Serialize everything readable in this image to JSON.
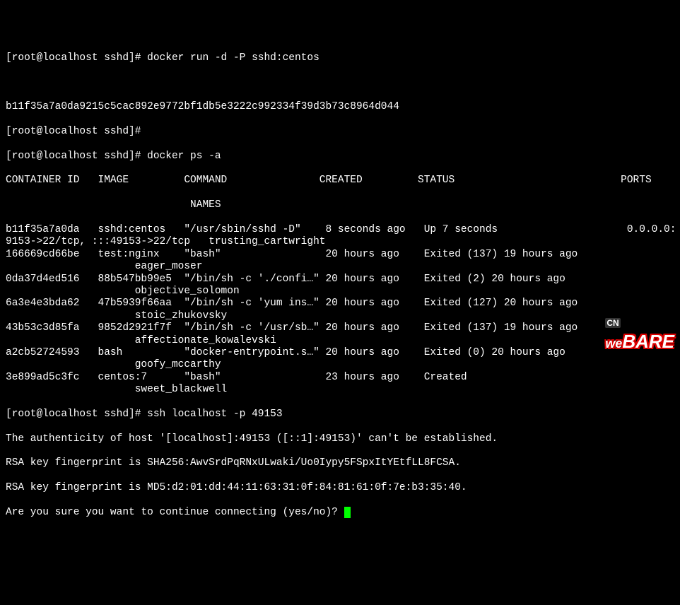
{
  "prompt": "[root@localhost sshd]#",
  "cmd1": "docker run -d -P sshd:centos",
  "output1": "b11f35a7a0da9215c5cac892e9772bf1db5e3222c992334f39d3b73c8964d044",
  "cmd2": "docker ps -a",
  "table_header": "CONTAINER ID   IMAGE         COMMAND               CREATED         STATUS                           PORTS",
  "table_header2": "                              NAMES",
  "rows": [
    {
      "l1": "b11f35a7a0da   sshd:centos   \"/usr/sbin/sshd -D\"    8 seconds ago   Up 7 seconds                     0.0.0.0:",
      "l2": "9153->22/tcp, :::49153->22/tcp   trusting_cartwright"
    },
    {
      "l1": "166669cd66be   test:nginx    \"bash\"                 20 hours ago    Exited (137) 19 hours ago",
      "l2": "                     eager_moser"
    },
    {
      "l1": "0da37d4ed516   88b547bb99e5  \"/bin/sh -c './confi…\" 20 hours ago    Exited (2) 20 hours ago",
      "l2": "                     objective_solomon"
    },
    {
      "l1": "6a3e4e3bda62   47b5939f66aa  \"/bin/sh -c 'yum ins…\" 20 hours ago    Exited (127) 20 hours ago",
      "l2": "                     stoic_zhukovsky"
    },
    {
      "l1": "43b53c3d85fa   9852d2921f7f  \"/bin/sh -c '/usr/sb…\" 20 hours ago    Exited (137) 19 hours ago",
      "l2": "                     affectionate_kowalevski"
    },
    {
      "l1": "a2cb52724593   bash          \"docker-entrypoint.s…\" 20 hours ago    Exited (0) 20 hours ago",
      "l2": "                     goofy_mccarthy"
    },
    {
      "l1": "3e899ad5c3fc   centos:7      \"bash\"                 23 hours ago    Created",
      "l2": "                     sweet_blackwell"
    }
  ],
  "cmd3": "ssh localhost -p 49153",
  "ssh_lines": [
    "The authenticity of host '[localhost]:49153 ([::1]:49153)' can't be established.",
    "RSA key fingerprint is SHA256:AwvSrdPqRNxULwaki/Uo0Iypy5FSpxItYEtfLL8FCSA.",
    "RSA key fingerprint is MD5:d2:01:dd:44:11:63:31:0f:84:81:61:0f:7e:b3:35:40.",
    "Are you sure you want to continue connecting (yes/no)? "
  ],
  "watermark": {
    "cn": "CN",
    "we": "we",
    "bare": "BARE"
  }
}
